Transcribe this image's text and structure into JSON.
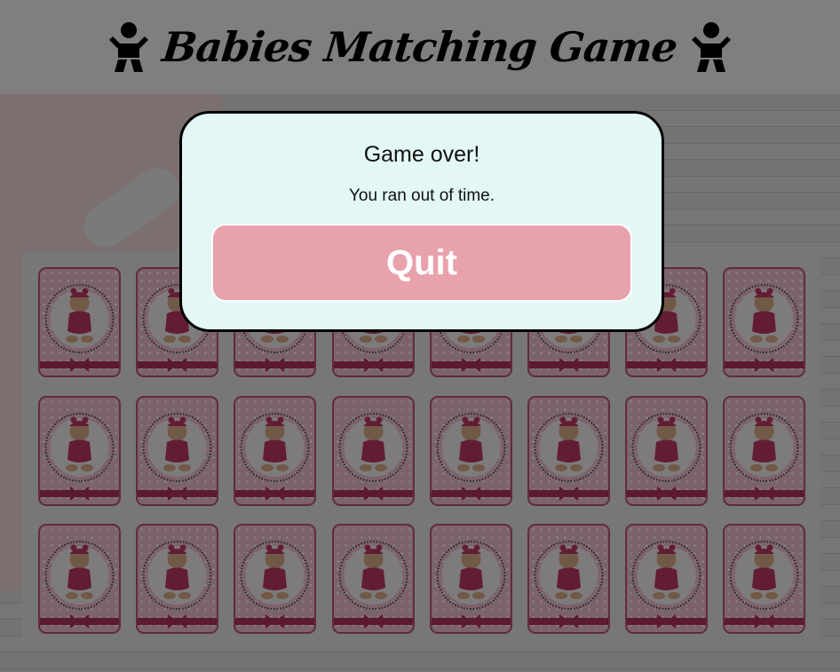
{
  "header": {
    "title": "Babies Matching Game",
    "left_icon": "baby-icon",
    "right_icon": "baby-icon"
  },
  "board": {
    "rows": 3,
    "columns": 8,
    "card_back_icon": "baby-girl-card-back",
    "colors": {
      "card_back": "#f8c6d4",
      "card_border": "#c0587a",
      "baby_outfit": "#c43a6b",
      "ribbon": "#b8355f"
    }
  },
  "modal": {
    "title": "Game over!",
    "message": "You ran out of time.",
    "quit_label": "Quit",
    "colors": {
      "background": "#e3f7f5",
      "button": "#e8a2ac"
    }
  }
}
